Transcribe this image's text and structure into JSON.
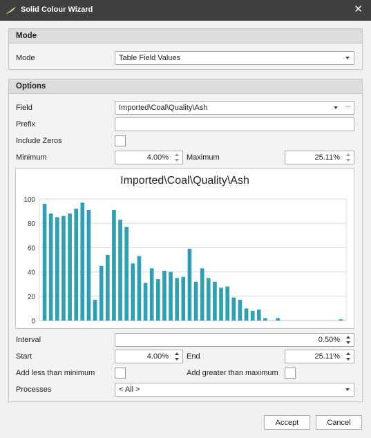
{
  "window": {
    "title": "Solid Colour Wizard",
    "close_label": "✕",
    "logo_icon": "feather-icon"
  },
  "mode_group": {
    "header": "Mode",
    "mode_label": "Mode",
    "mode_value": "Table Field Values"
  },
  "options_group": {
    "header": "Options",
    "field_label": "Field",
    "field_value": "Imported\\Coal\\Quality\\Ash",
    "field_ellipsis": "···",
    "prefix_label": "Prefix",
    "prefix_value": "",
    "include_zeros_label": "Include Zeros",
    "include_zeros_checked": false,
    "minimum_label": "Minimum",
    "minimum_value": "4.00%",
    "maximum_label": "Maximum",
    "maximum_value": "25.11%",
    "interval_label": "Interval",
    "interval_value": "0.50%",
    "start_label": "Start",
    "start_value": "4.00%",
    "end_label": "End",
    "end_value": "25.11%",
    "add_less_label": "Add less than minimum",
    "add_less_checked": false,
    "add_greater_label": "Add greater than maximum",
    "add_greater_checked": false,
    "processes_label": "Processes",
    "processes_value": "< All >"
  },
  "buttons": {
    "accept": "Accept",
    "cancel": "Cancel"
  },
  "colors": {
    "bar": "#2e9fb4",
    "titlebar": "#3f3f3f",
    "grid": "#dcdcdc"
  },
  "chart_data": {
    "type": "bar",
    "title": "Imported\\Coal\\Quality\\Ash",
    "ylim": [
      0,
      100
    ],
    "yticks": [
      0,
      20,
      40,
      60,
      80,
      100
    ],
    "grid": true,
    "values": [
      96,
      88,
      85,
      86,
      88,
      92,
      97,
      91,
      17,
      45,
      54,
      91,
      83,
      77,
      47,
      53,
      31,
      43,
      34,
      41,
      40,
      35,
      36,
      59,
      32,
      43,
      35,
      32,
      27,
      28,
      19,
      17,
      10,
      8,
      9,
      2,
      0,
      2,
      0,
      0,
      0,
      0,
      0,
      0,
      0,
      0,
      0,
      1
    ]
  }
}
